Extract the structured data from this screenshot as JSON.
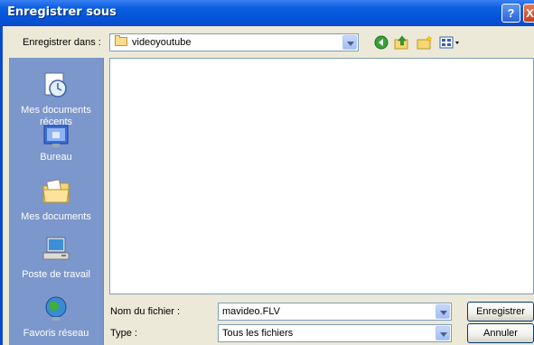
{
  "window": {
    "title": "Enregistrer sous",
    "help_label": "?",
    "close_label": "X"
  },
  "location": {
    "label": "Enregistrer dans :",
    "folder": "videoyoutube"
  },
  "toolbar": {
    "icons": [
      "back-icon",
      "up-folder-icon",
      "new-folder-icon",
      "view-menu-icon"
    ]
  },
  "places": [
    {
      "label": "Mes documents récents",
      "icon": "recent-documents-icon"
    },
    {
      "label": "Bureau",
      "icon": "desktop-icon"
    },
    {
      "label": "Mes documents",
      "icon": "my-documents-icon"
    },
    {
      "label": "Poste de travail",
      "icon": "my-computer-icon"
    },
    {
      "label": "Favoris réseau",
      "icon": "network-places-icon"
    }
  ],
  "filename": {
    "label": "Nom du fichier :",
    "value": "mavideo.FLV"
  },
  "filetype": {
    "label": "Type :",
    "value": "Tous les fichiers"
  },
  "buttons": {
    "save": "Enregistrer",
    "cancel": "Annuler"
  }
}
